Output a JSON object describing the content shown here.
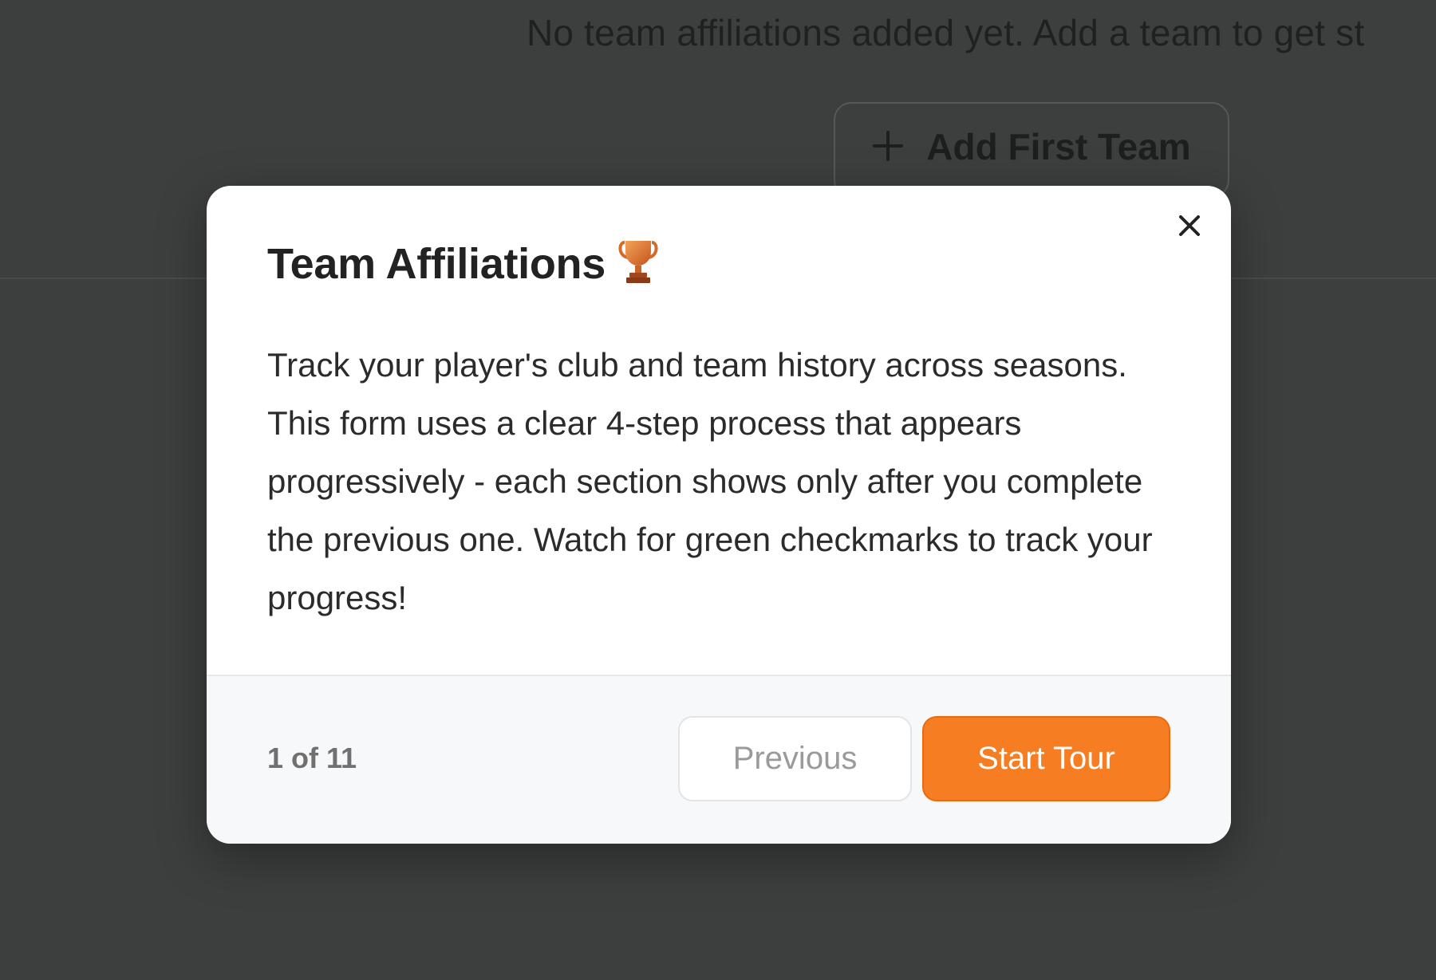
{
  "background": {
    "empty_state_text": "No team affiliations added yet. Add a team to get st",
    "add_button": {
      "icon": "plus-icon",
      "label": "Add First Team"
    }
  },
  "tour_modal": {
    "title": "Team Affiliations",
    "title_icon": "trophy-icon",
    "body": "Track your player's club and team history across seasons. This form uses a clear 4-step process that appears progressively - each section shows only after you complete the previous one. Watch for green checkmarks to track your progress!",
    "close_icon": "close-icon",
    "step_counter": "1 of 11",
    "previous_label": "Previous",
    "start_label": "Start Tour"
  },
  "colors": {
    "accent": "#f77d23",
    "overlay": "#3d3f3e"
  }
}
